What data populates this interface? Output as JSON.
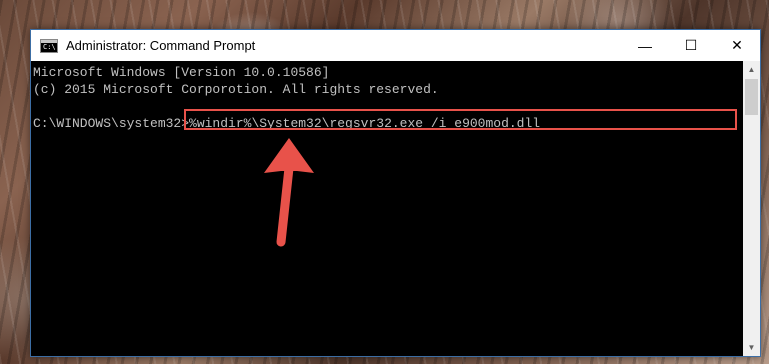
{
  "window": {
    "title": "Administrator: Command Prompt",
    "icon_text": "C:\\",
    "minimize_glyph": "—",
    "maximize_glyph": "☐",
    "close_glyph": "✕"
  },
  "console": {
    "lines": [
      "Microsoft Windows [Version 10.0.10586]",
      "(c) 2015 Microsoft Corporotion. All rights reserved.",
      ""
    ],
    "prompt": "C:\\WINDOWS\\system32>",
    "command": "%windir%\\System32\\regsvr32.exe /i e900mod.dll"
  },
  "annotation": {
    "highlight_color": "#e8524a",
    "arrow_color": "#e8524a"
  },
  "scrollbar": {
    "up_glyph": "▲",
    "down_glyph": "▼"
  }
}
